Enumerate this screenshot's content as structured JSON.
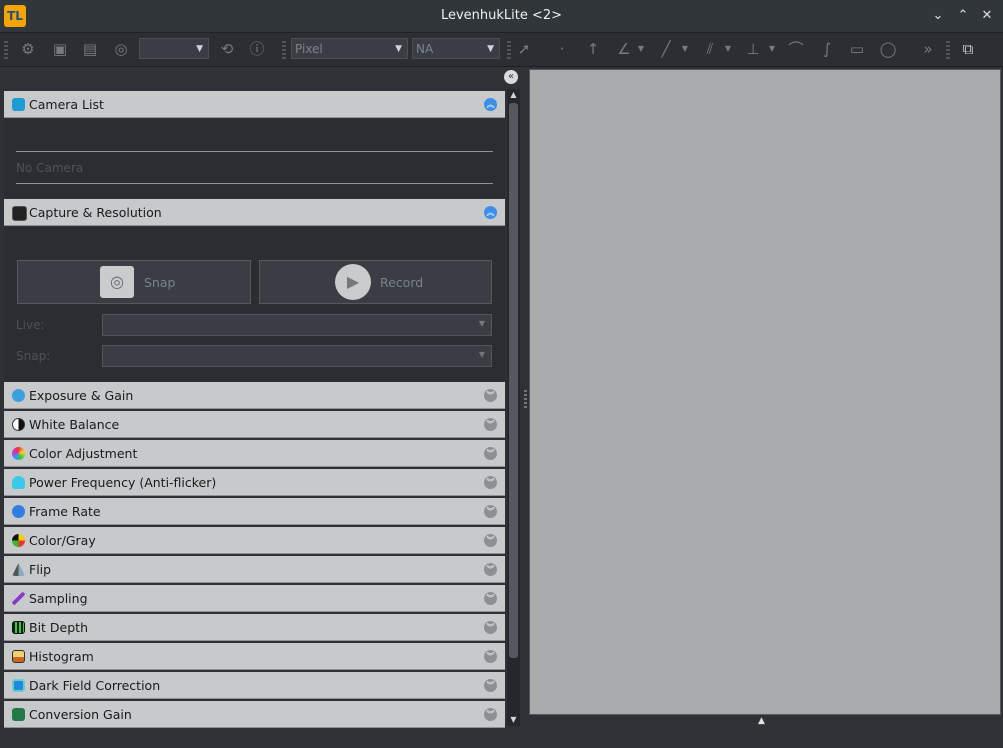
{
  "window": {
    "logo_text": "TL",
    "title": "LevenhukLite <2>",
    "controls": [
      "⌄",
      "⌃",
      "✕"
    ]
  },
  "toolbar": {
    "unit_select": "Pixel",
    "magnification_select": "NA"
  },
  "sections": [
    {
      "label": "Camera List",
      "icon": "camera-list-icon",
      "expanded": true
    },
    {
      "label": "Capture & Resolution",
      "icon": "camera-icon",
      "expanded": true
    },
    {
      "label": "Exposure & Gain",
      "icon": "exposure-icon",
      "expanded": false
    },
    {
      "label": "White Balance",
      "icon": "white-balance-icon",
      "expanded": false
    },
    {
      "label": "Color Adjustment",
      "icon": "color-wheel-icon",
      "expanded": false
    },
    {
      "label": "Power Frequency (Anti-flicker)",
      "icon": "bulb-icon",
      "expanded": false
    },
    {
      "label": "Frame Rate",
      "icon": "frame-rate-icon",
      "expanded": false
    },
    {
      "label": "Color/Gray",
      "icon": "color-gray-icon",
      "expanded": false
    },
    {
      "label": "Flip",
      "icon": "flip-icon",
      "expanded": false
    },
    {
      "label": "Sampling",
      "icon": "sampling-icon",
      "expanded": false
    },
    {
      "label": "Bit Depth",
      "icon": "bit-depth-icon",
      "expanded": false
    },
    {
      "label": "Histogram",
      "icon": "histogram-icon",
      "expanded": false
    },
    {
      "label": "Dark Field Correction",
      "icon": "dark-field-icon",
      "expanded": false
    },
    {
      "label": "Conversion Gain",
      "icon": "conversion-gain-icon",
      "expanded": false
    }
  ],
  "camera_list": {
    "empty_text": "No Camera"
  },
  "capture": {
    "snap_label": "Snap",
    "record_label": "Record",
    "live_label": "Live:",
    "snap_res_label": "Snap:"
  },
  "colors": {
    "accent": "#3d8ee8",
    "header_bg": "#c7c9cb",
    "view_bg": "#a9aaab"
  }
}
